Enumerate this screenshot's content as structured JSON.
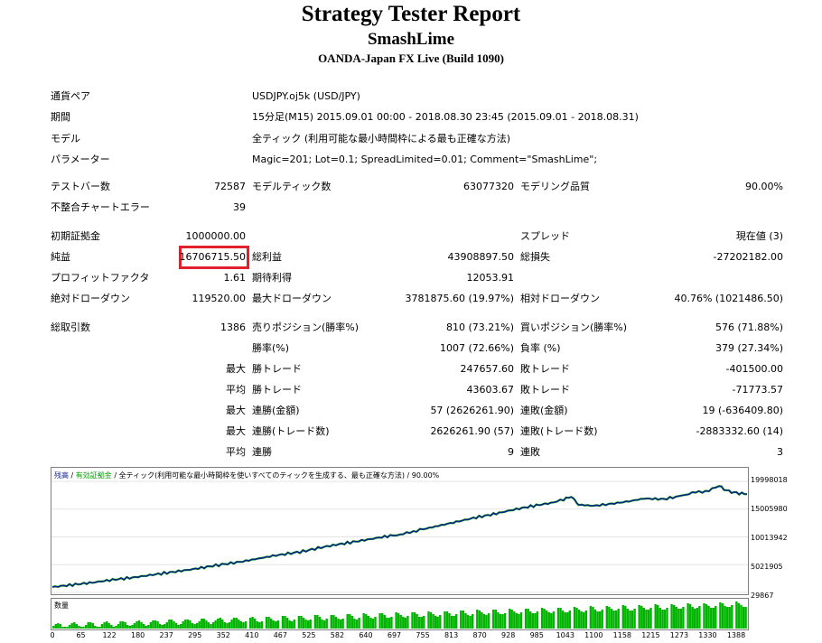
{
  "header": {
    "title": "Strategy Tester Report",
    "expert": "SmashLime",
    "server": "OANDA-Japan FX Live (Build 1090)"
  },
  "settings": {
    "symbol_label": "通貨ペア",
    "symbol_value": "USDJPY.oj5k (USD/JPY)",
    "period_label": "期間",
    "period_value": "15分足(M15) 2015.09.01 00:00 - 2018.08.30 23:45 (2015.09.01 - 2018.08.31)",
    "model_label": "モデル",
    "model_value": "全ティック (利用可能な最小時間枠による最も正確な方法)",
    "params_label": "パラメーター",
    "params_value": "Magic=201; Lot=0.1; SpreadLimited=0.01; Comment=\"SmashLime\";"
  },
  "stats": {
    "bars_label": "テストバー数",
    "bars_value": "72587",
    "ticks_label": "モデルティック数",
    "ticks_value": "63077320",
    "quality_label": "モデリング品質",
    "quality_value": "90.00%",
    "mismatch_label": "不整合チャートエラー",
    "mismatch_value": "39",
    "deposit_label": "初期証拠金",
    "deposit_value": "1000000.00",
    "spread_label": "スプレッド",
    "spread_value": "現在値 (3)",
    "net_label": "純益",
    "net_value": "16706715.50",
    "gross_profit_label": "総利益",
    "gross_profit_value": "43908897.50",
    "gross_loss_label": "総損失",
    "gross_loss_value": "-27202182.00",
    "pf_label": "プロフィットファクタ",
    "pf_value": "1.61",
    "expected_label": "期待利得",
    "expected_value": "12053.91",
    "abs_dd_label": "絶対ドローダウン",
    "abs_dd_value": "119520.00",
    "max_dd_label": "最大ドローダウン",
    "max_dd_value": "3781875.60 (19.97%)",
    "rel_dd_label": "相対ドローダウン",
    "rel_dd_value": "40.76% (1021486.50)",
    "trades_label": "総取引数",
    "trades_value": "1386",
    "short_label": "売りポジション(勝率%)",
    "short_value": "810 (73.21%)",
    "long_label": "買いポジション(勝率%)",
    "long_value": "576 (71.88%)",
    "win_label": "勝率(%)",
    "win_value": "1007 (72.66%)",
    "loss_label": "負率 (%)",
    "loss_value": "379 (27.34%)",
    "max_word": "最大",
    "avg_word": "平均",
    "largest_win_label": "勝トレード",
    "largest_win_value": "247657.60",
    "largest_loss_label": "敗トレード",
    "largest_loss_value": "-401500.00",
    "avg_win_label": "勝トレード",
    "avg_win_value": "43603.67",
    "avg_loss_label": "敗トレード",
    "avg_loss_value": "-71773.57",
    "max_consec_win_label": "連勝(金額)",
    "max_consec_win_value": "57 (2626261.90)",
    "max_consec_loss_label": "連敗(金額)",
    "max_consec_loss_value": "19 (-636409.80)",
    "max_consec_profit_label": "連勝(トレード数)",
    "max_consec_profit_value": "2626261.90 (57)",
    "max_consec_lossamt_label": "連敗(トレード数)",
    "max_consec_lossamt_value": "-2883332.60 (14)",
    "avg_consec_win_label": "連勝",
    "avg_consec_win_value": "9",
    "avg_consec_loss_label": "連敗",
    "avg_consec_loss_value": "3"
  },
  "chart": {
    "legend_balance": "残高",
    "legend_sep1": " / ",
    "legend_equity": "有効証拠金",
    "legend_sep2": " / ",
    "legend_model": "全ティック(利用可能な最小時間枠を使いすべてのティックを生成する、最も正確な方法)",
    "legend_sep3": " / ",
    "legend_quality": "90.00%",
    "volume_label": "数量",
    "colors": {
      "balance": "#0a1e8c",
      "equity": "#00a000",
      "volume": "#00b400"
    }
  },
  "chart_data": {
    "type": "line",
    "ylim": [
      29867,
      19998018
    ],
    "y_ticks": [
      "19998018",
      "15005980",
      "10013942",
      "5021905",
      "29867"
    ],
    "x_ticks": [
      "0",
      "65",
      "122",
      "180",
      "237",
      "295",
      "352",
      "410",
      "467",
      "525",
      "582",
      "640",
      "697",
      "755",
      "813",
      "870",
      "928",
      "985",
      "1043",
      "1100",
      "1158",
      "1215",
      "1273",
      "1330",
      "1388"
    ],
    "xlim": [
      0,
      1386
    ],
    "series": [
      {
        "x": [
          0,
          40,
          80,
          120,
          160,
          200,
          240,
          280,
          320,
          350,
          380,
          410,
          440,
          470,
          500,
          530,
          560,
          600,
          640,
          680,
          700,
          720,
          740,
          770,
          800,
          840,
          880,
          920,
          960,
          1000,
          1020,
          1035,
          1043,
          1050,
          1080,
          1110,
          1150,
          1180,
          1220,
          1250,
          1270,
          1290,
          1310,
          1330,
          1340,
          1350,
          1365,
          1386
        ],
        "y": [
          1000000,
          1400000,
          1800000,
          2300000,
          2700000,
          3200000,
          3700000,
          4200000,
          4800000,
          5200000,
          5600000,
          6100000,
          6600000,
          7000000,
          7400000,
          8000000,
          8500000,
          9100000,
          9700000,
          10300000,
          10500000,
          11000000,
          11400000,
          12000000,
          12600000,
          13400000,
          14100000,
          14900000,
          15600000,
          16200000,
          16700000,
          17300000,
          16400000,
          15800000,
          15600000,
          15900000,
          16400000,
          16900000,
          16800000,
          17300000,
          17800000,
          18100000,
          18300000,
          19200000,
          18600000,
          18200000,
          17900000,
          17700000
        ]
      }
    ]
  }
}
